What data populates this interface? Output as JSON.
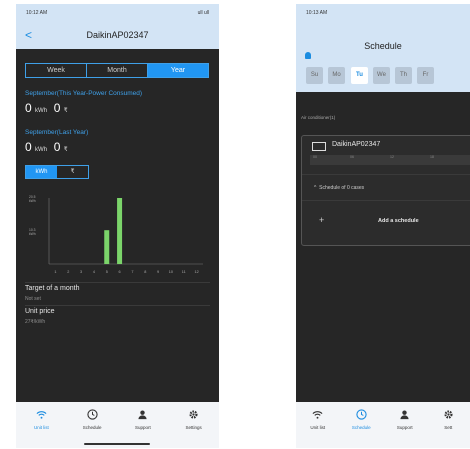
{
  "left_screen": {
    "status": {
      "time": "10:12 AM",
      "signal": "ull ull"
    },
    "header": {
      "back": "<",
      "title": "DaikinAP02347"
    },
    "tabs": [
      "Week",
      "Month",
      "Year"
    ],
    "this_year_label": "September(This Year-Power Consumed)",
    "this_year_kwh": "0",
    "this_year_kwh_unit": "kWh",
    "this_year_cost": "0",
    "this_year_cost_unit": "₹",
    "last_year_label": "September(Last Year)",
    "last_year_kwh": "0",
    "last_year_kwh_unit": "kWh",
    "last_year_cost": "0",
    "last_year_cost_unit": "₹",
    "unit_toggle": [
      "kWh",
      "₹"
    ],
    "target_title": "Target of a month",
    "target_value": "Not set",
    "unit_price_title": "Unit price",
    "unit_price_value": "27₹/kWh"
  },
  "chart_data": {
    "type": "bar",
    "categories": [
      "1",
      "2",
      "3",
      "4",
      "5",
      "6",
      "7",
      "8",
      "9",
      "10",
      "11",
      "12"
    ],
    "values": [
      0,
      0,
      0,
      0,
      10.5,
      20.5,
      0,
      0,
      0,
      0,
      0,
      0
    ],
    "ylim": [
      0,
      20.5
    ],
    "yticks": [
      "20.5 kWh",
      "10.3 kWh"
    ],
    "bar_color": "#7bd46a"
  },
  "nav": [
    {
      "label": "Unit list",
      "icon": "wifi-icon"
    },
    {
      "label": "Schedule",
      "icon": "clock-icon"
    },
    {
      "label": "Support",
      "icon": "person-icon"
    },
    {
      "label": "Settings",
      "icon": "gear-icon"
    }
  ],
  "right_screen": {
    "status": {
      "time": "10:13 AM"
    },
    "header": {
      "title": "Schedule"
    },
    "days": [
      "Su",
      "Mo",
      "Tu",
      "We",
      "Th",
      "Fr"
    ],
    "selected_day": "Tu",
    "section_label": "Air conditioner(1)",
    "device_name": "DaikinAP02347",
    "timeline_ticks": [
      "00",
      "06",
      "12",
      "18"
    ],
    "schedule_label": "Schedule of 0 cases",
    "add_label": "Add a schedule",
    "nav": [
      {
        "label": "Unit list",
        "icon": "wifi-icon"
      },
      {
        "label": "Schedule",
        "icon": "clock-icon"
      },
      {
        "label": "Support",
        "icon": "person-icon"
      },
      {
        "label": "Sett",
        "icon": "gear-icon"
      }
    ]
  }
}
